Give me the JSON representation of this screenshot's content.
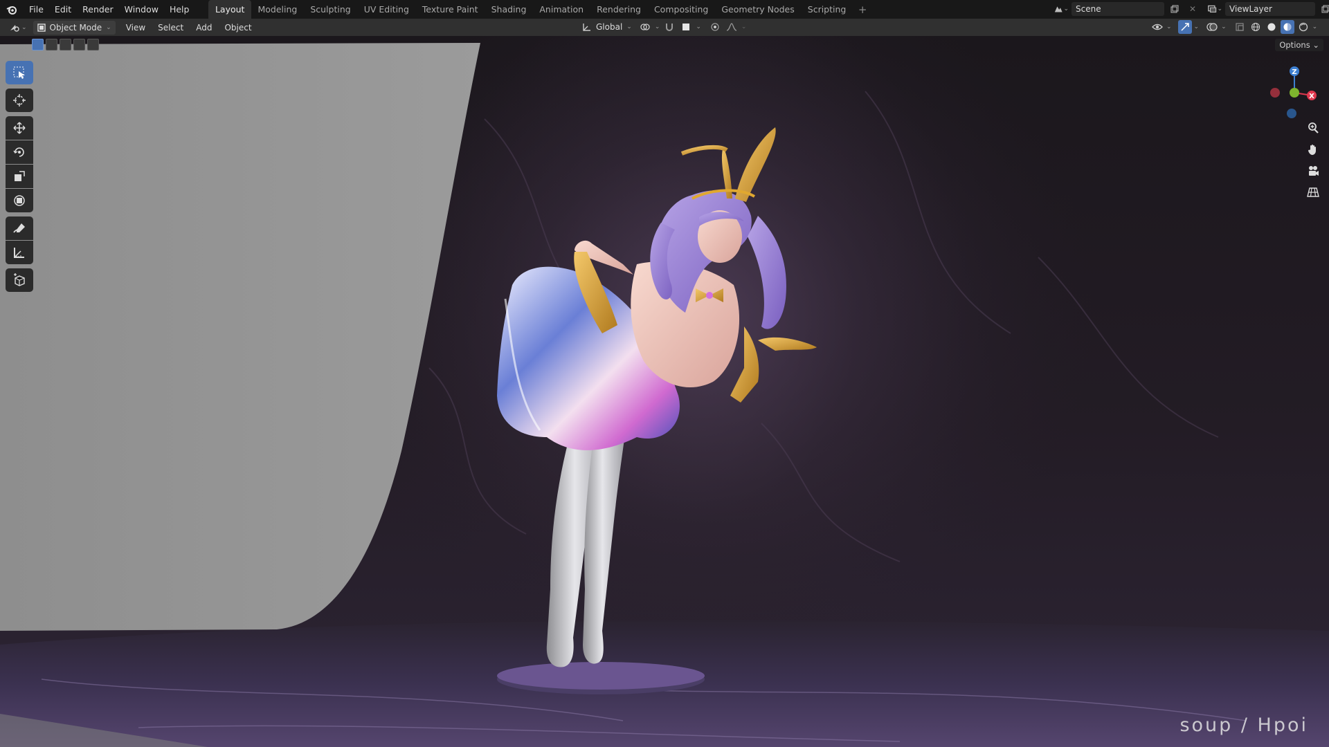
{
  "topbar": {
    "menu": [
      "File",
      "Edit",
      "Render",
      "Window",
      "Help"
    ],
    "workspaces": [
      "Layout",
      "Modeling",
      "Sculpting",
      "UV Editing",
      "Texture Paint",
      "Shading",
      "Animation",
      "Rendering",
      "Compositing",
      "Geometry Nodes",
      "Scripting"
    ],
    "active_workspace": "Layout",
    "add_workspace": "+",
    "scene": "Scene",
    "view_layer": "ViewLayer"
  },
  "header": {
    "mode": "Object Mode",
    "menus": [
      "View",
      "Select",
      "Add",
      "Object"
    ],
    "orientation": "Global"
  },
  "viewport": {
    "options_label": "Options",
    "watermark": "soup / Hpoi",
    "gizmo_axes": [
      "X",
      "Y",
      "Z"
    ]
  },
  "toolbar": {
    "tools": [
      "select-box",
      "cursor",
      "move",
      "rotate",
      "scale",
      "transform",
      "annotate",
      "measure",
      "add-cube"
    ],
    "active_tool": "select-box"
  },
  "colors": {
    "accent": "#4772b3",
    "axis_x": "#e0384f",
    "axis_y": "#7eb52e",
    "axis_z": "#3d7fd1"
  }
}
